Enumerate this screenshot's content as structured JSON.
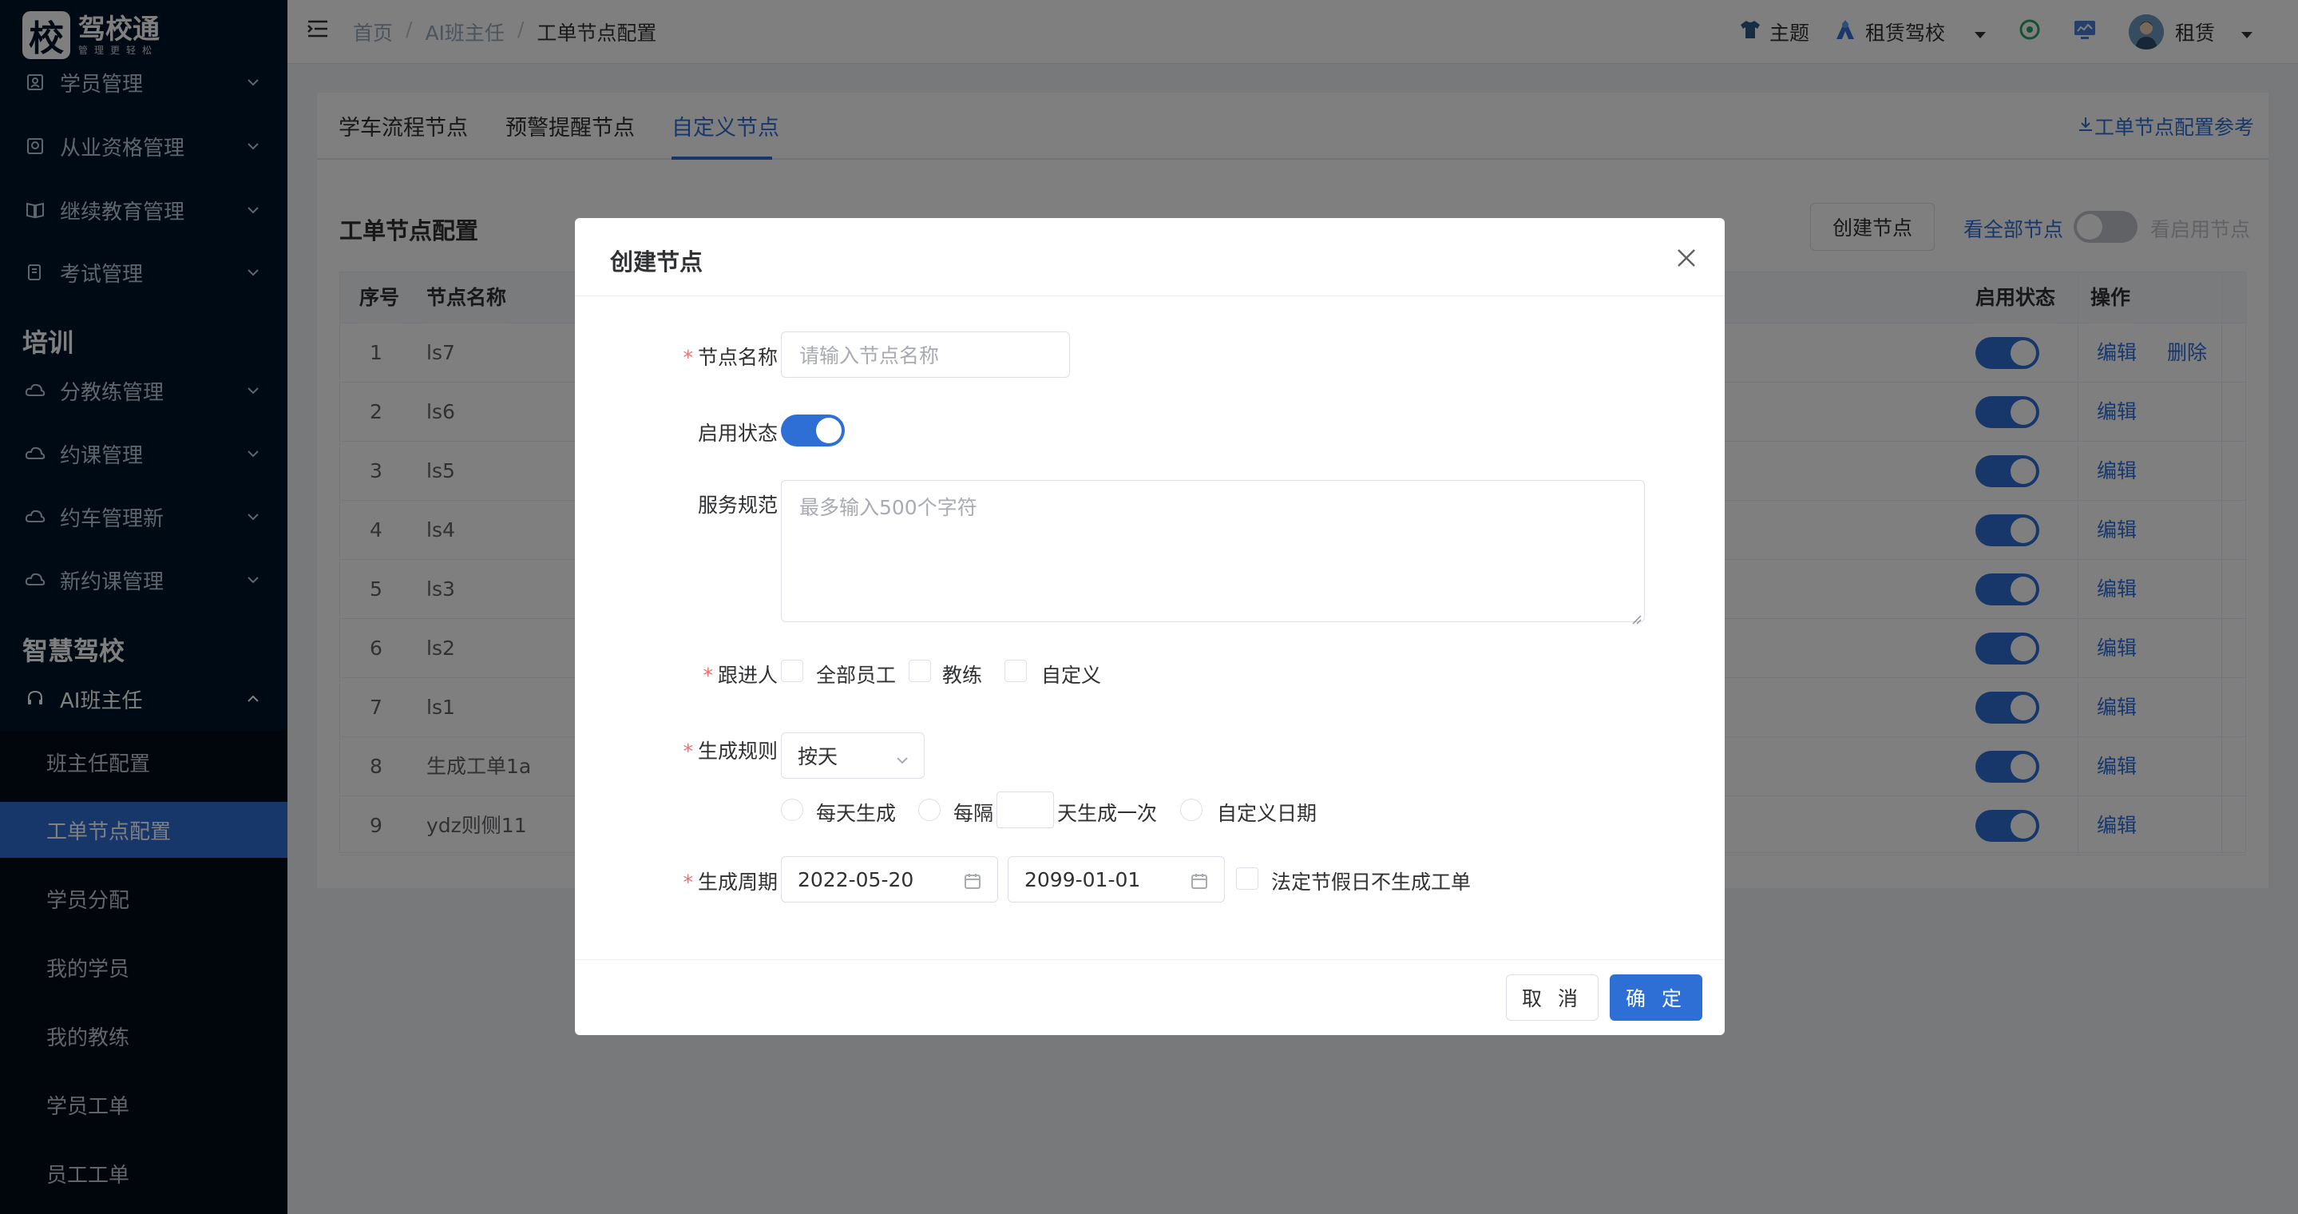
{
  "app": {
    "logo_mark": "校",
    "logo_title": "驾校通",
    "logo_sub": "管理更轻松"
  },
  "sidebar": {
    "items_top": [
      {
        "label": "学员管理",
        "icon": "student-icon"
      },
      {
        "label": "从业资格管理",
        "icon": "certificate-icon"
      },
      {
        "label": "继续教育管理",
        "icon": "book-icon"
      },
      {
        "label": "考试管理",
        "icon": "exam-icon"
      }
    ],
    "group_training": "培训",
    "items_training": [
      {
        "label": "分教练管理",
        "icon": "cloud-icon"
      },
      {
        "label": "约课管理",
        "icon": "cloud-icon"
      },
      {
        "label": "约车管理新",
        "icon": "cloud-icon"
      },
      {
        "label": "新约课管理",
        "icon": "cloud-icon"
      }
    ],
    "group_smart": "智慧驾校",
    "ai_menu": {
      "label": "AI班主任",
      "icon": "headset-icon"
    },
    "ai_sub": [
      {
        "label": "班主任配置"
      },
      {
        "label": "工单节点配置"
      },
      {
        "label": "学员分配"
      },
      {
        "label": "我的学员"
      },
      {
        "label": "我的教练"
      },
      {
        "label": "学员工单"
      },
      {
        "label": "员工工单"
      }
    ]
  },
  "header": {
    "breadcrumb": [
      "首页",
      "AI班主任",
      "工单节点配置"
    ],
    "sep": "/",
    "theme": "主题",
    "school": "租赁驾校",
    "user": "租赁"
  },
  "tabs": {
    "items": [
      "学车流程节点",
      "预警提醒节点",
      "自定义节点"
    ],
    "link": "工单节点配置参考"
  },
  "section": {
    "title": "工单节点配置",
    "create_btn": "创建节点",
    "view_all": "看全部节点",
    "view_enabled": "看启用节点"
  },
  "table": {
    "columns": {
      "index": "序号",
      "name": "节点名称",
      "status": "启用状态",
      "ops": "操作"
    },
    "rows": [
      {
        "index": "1",
        "name": "ls7",
        "ops": [
          "编辑",
          "删除"
        ]
      },
      {
        "index": "2",
        "name": "ls6",
        "ops": [
          "编辑"
        ]
      },
      {
        "index": "3",
        "name": "ls5",
        "ops": [
          "编辑"
        ]
      },
      {
        "index": "4",
        "name": "ls4",
        "ops": [
          "编辑"
        ]
      },
      {
        "index": "5",
        "name": "ls3",
        "ops": [
          "编辑"
        ]
      },
      {
        "index": "6",
        "name": "ls2",
        "ops": [
          "编辑"
        ]
      },
      {
        "index": "7",
        "name": "ls1",
        "ops": [
          "编辑"
        ]
      },
      {
        "index": "8",
        "name": "生成工单1a",
        "ops": [
          "编辑"
        ]
      },
      {
        "index": "9",
        "name": "ydz则侧11",
        "ops": [
          "编辑"
        ]
      }
    ]
  },
  "dialog": {
    "title": "创建节点",
    "name_label": "节点名称",
    "name_placeholder": "请输入节点名称",
    "status_label": "启用状态",
    "spec_label": "服务规范",
    "spec_placeholder": "最多输入500个字符",
    "follower_label": "跟进人",
    "follower_options": [
      "全部员工",
      "教练",
      "自定义"
    ],
    "rule_label": "生成规则",
    "rule_value": "按天",
    "rule_options": {
      "daily": "每天生成",
      "every_prefix": "每隔",
      "every_suffix": "天生成一次",
      "custom": "自定义日期"
    },
    "period_label": "生成周期",
    "start_date": "2022-05-20",
    "end_date": "2099-01-01",
    "holiday_label": "法定节假日不生成工单",
    "cancel": "取 消",
    "confirm": "确 定"
  },
  "colors": {
    "primary": "#2e6fd6",
    "sidebar_bg": "#001529",
    "danger": "#f56c6c"
  }
}
